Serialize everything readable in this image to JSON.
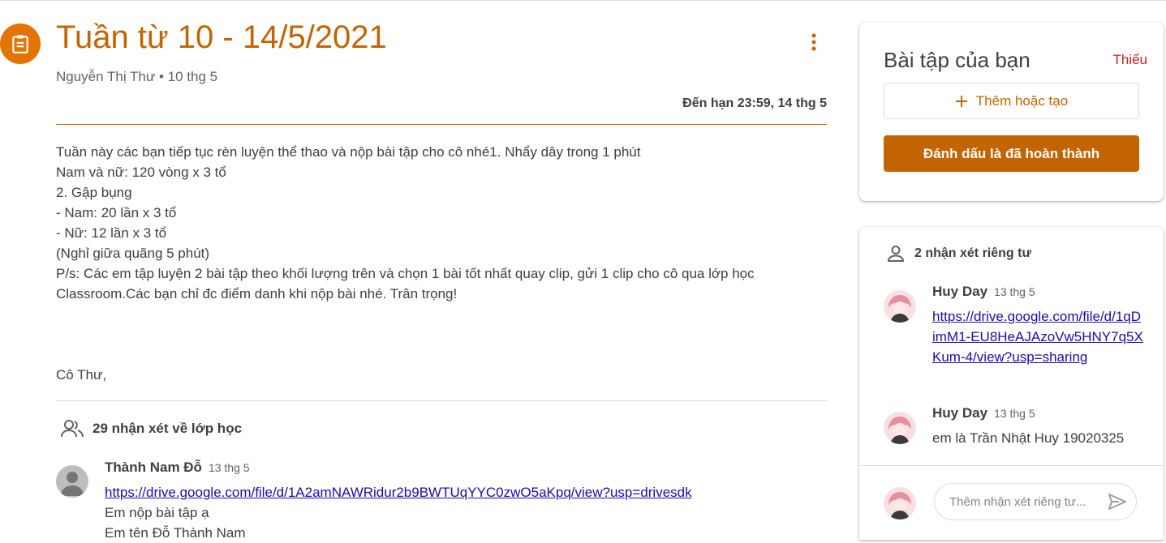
{
  "assignment": {
    "title": "Tuần từ 10 - 14/5/2021",
    "author": "Nguyễn Thị Thư",
    "meta_separator": " • ",
    "posted": "10 thg 5",
    "due": "Đến hạn 23:59, 14 thg 5",
    "description_lines": [
      "Tuần này các bạn tiếp tục rèn luyện thể thao và nộp bài tập cho cô nhé1. Nhẩy dây trong 1 phút",
      "Nam và nữ: 120 vòng x 3 tổ",
      "2. Gập bụng",
      "- Nam: 20 lần x 3 tổ",
      "- Nữ: 12 lần x 3 tổ",
      "(Nghỉ giữa quãng 5 phút)",
      "P/s: Các em tập luyện 2 bài tập theo khối lượng trên và chọn 1 bài tốt nhất quay clip, gửi 1 clip cho cô qua lớp học",
      "Classroom.Các bạn chỉ đc điểm danh khi nộp bài nhé.  Trân trọng!"
    ],
    "signature": "Cô Thư,"
  },
  "class_comments": {
    "header": "29 nhận xét về lớp học",
    "items": [
      {
        "author": "Thành Nam Đỗ",
        "date": "13 thg 5",
        "link": "https://drive.google.com/file/d/1A2amNAWRidur2b9BWTUqYYC0zwO5aKpq/view?usp=drivesdk",
        "lines": [
          "Em nộp bài tập ạ",
          "Em tên Đỗ Thành Nam"
        ]
      }
    ]
  },
  "your_work": {
    "title": "Bài tập của bạn",
    "status": "Thiếu",
    "add_label": "Thêm hoặc tạo",
    "mark_done_label": "Đánh dấu là đã hoàn thành"
  },
  "private_comments": {
    "header": "2 nhận xét riêng tư",
    "items": [
      {
        "author": "Huy Day",
        "date": "13 thg 5",
        "link": "https://drive.google.com/file/d/1qDimM1-EU8HeAJAzoVw5HNY7q5XKum-4/view?usp=sharing"
      },
      {
        "author": "Huy Day",
        "date": "13 thg 5",
        "text": "em là Trần Nhật Huy 19020325"
      }
    ],
    "input_placeholder": "Thêm nhận xét riêng tư..."
  },
  "colors": {
    "accent": "#c26401",
    "icon_bg": "#e37400",
    "status_missing": "#c5221f",
    "link": "#1a0dab"
  },
  "icons": [
    "assignment-icon",
    "more-vert-icon",
    "add-icon",
    "people-icon",
    "person-icon",
    "send-icon"
  ]
}
